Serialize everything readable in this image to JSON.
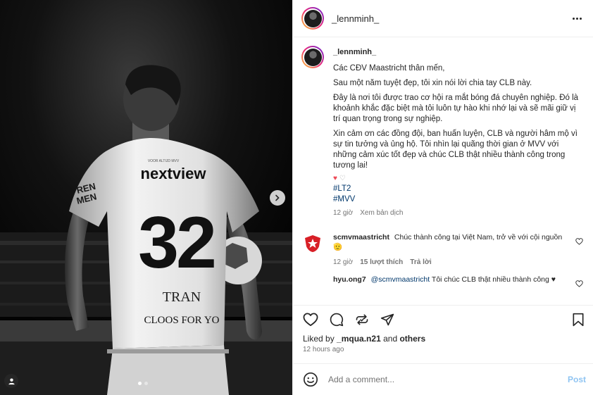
{
  "post": {
    "username": "_lennminh_",
    "caption": [
      "Các CĐV Maastricht thân mến,",
      "Sau một năm tuyệt đẹp, tôi xin nói lời chia tay CLB này.",
      "Đây là nơi tôi được trao cơ hội ra mắt bóng đá chuyên nghiệp. Đó là khoảnh khắc đặc biệt mà tôi luôn tự hào khi nhớ lại và sẽ mãi giữ vị trí quan trọng trong sự nghiệp.",
      "Xin cảm ơn các đồng đội, ban huấn luyện, CLB và người hâm mộ vì sự tin tưởng và ủng hộ. Tôi nhìn lại quãng thời gian ở MVV với những cảm xúc tốt đẹp và chúc CLB thật nhiều thành công trong tương lai!"
    ],
    "emoji": "♥",
    "emoji2": "♡",
    "hashtags": [
      "#LT2",
      "#MVV"
    ],
    "caption_time": "12 giờ",
    "translate": "Xem bản dịch"
  },
  "photo": {
    "sponsor": "nextview",
    "number": "32",
    "name": "TRAN",
    "sleeve": "CLOOS FOR YO",
    "slide_count": 2,
    "active_slide": 1
  },
  "comments": [
    {
      "user": "scmvmaastricht",
      "text": "Chúc thành công tại Việt Nam, trở về với cội nguồn 🫡",
      "time": "12 giờ",
      "likes": "15 lượt thích",
      "reply": "Trả lời"
    },
    {
      "user": "hyu.ong7",
      "mention": "@scmvmaastricht",
      "text": "Tôi chúc CLB thật nhiều thành công ♥"
    }
  ],
  "likes": {
    "prefix": "Liked by",
    "user": "_mqua.n21",
    "and": "and",
    "others": "others"
  },
  "time_ago": "12 hours ago",
  "add_comment": {
    "placeholder": "Add a comment...",
    "post_label": "Post"
  },
  "colors": {
    "link": "#00376b",
    "muted": "#737373",
    "post_disabled": "#8fc4f2",
    "club_red": "#d81f26"
  }
}
